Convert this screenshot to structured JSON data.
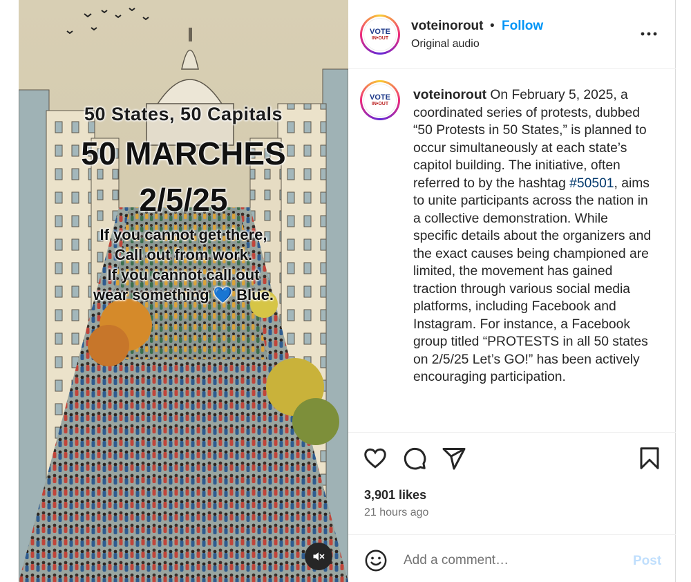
{
  "poster": {
    "line1": "50 States, 50 Capitals",
    "line2": "50 MARCHES",
    "line3": "2/5/25",
    "cta_line1": "If you cannot get there,",
    "cta_line2": "Call out from work.",
    "cta_line3": "If you cannot call out",
    "cta_line4_pre": "wear something",
    "cta_heart": "💙",
    "cta_line4_post": "Blue."
  },
  "header": {
    "avatar_line1": "VOTE",
    "avatar_line2": "IN•OUT",
    "username": "voteinorout",
    "separator": "•",
    "follow_label": "Follow",
    "audio": "Original audio"
  },
  "caption": {
    "username": "voteinorout",
    "text_before_tag": " On February 5, 2025, a coordinated series of protests, dubbed “50 Protests in 50 States,” is planned to occur simultaneously at each state’s capitol building. The initiative, often referred to by the hashtag ",
    "hashtag": "#50501",
    "text_after_tag": ", aims to unite participants across the nation in a collective demonstration. While specific details about the organizers and the exact causes being championed are limited, the movement has gained traction through various social media platforms, including Facebook and Instagram. For instance, a Facebook group titled “PROTESTS in all 50 states on 2/5/25 Let’s GO!” has been actively encouraging participation."
  },
  "stats": {
    "likes": "3,901 likes",
    "time": "21 hours ago"
  },
  "comment": {
    "placeholder": "Add a comment…",
    "post_label": "Post"
  },
  "icons": {
    "like": "heart-icon",
    "comment": "comment-icon",
    "share": "share-icon",
    "save": "bookmark-icon",
    "more": "more-icon",
    "mute": "muted-speaker-icon",
    "emoji": "emoji-icon"
  },
  "colors": {
    "follow": "#0095f6",
    "hashtag": "#00376b",
    "post_disabled": "#c0dffd",
    "secondary_text": "#737373"
  }
}
